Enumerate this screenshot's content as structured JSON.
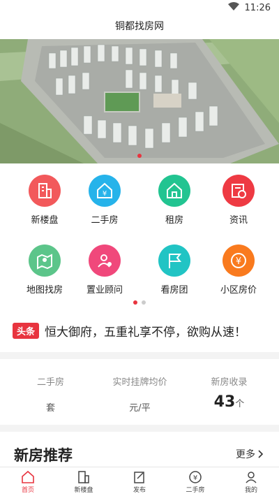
{
  "status_bar": {
    "time": "11:26"
  },
  "title": "铜都找房网",
  "banner": {
    "dot_count": 1
  },
  "grid": {
    "items": [
      {
        "label": "新楼盘",
        "icon": "building-icon",
        "color": "#f2595b"
      },
      {
        "label": "二手房",
        "icon": "yuan-house-icon",
        "color": "#26b3ea"
      },
      {
        "label": "租房",
        "icon": "house-icon",
        "color": "#22c491"
      },
      {
        "label": "资讯",
        "icon": "news-clock-icon",
        "color": "#ee3a43"
      },
      {
        "label": "地图找房",
        "icon": "map-pin-icon",
        "color": "#5cc58a"
      },
      {
        "label": "置业顾问",
        "icon": "advisor-icon",
        "color": "#f0487b"
      },
      {
        "label": "看房团",
        "icon": "flag-icon",
        "color": "#21c4c4"
      },
      {
        "label": "小区房价",
        "icon": "yuan-coin-icon",
        "color": "#f97a1e"
      }
    ],
    "page_count": 2,
    "active_page": 1
  },
  "headline": {
    "badge": "头条",
    "text": "恒大御府，五重礼享不停，欲购从速！"
  },
  "stats": {
    "second_hand": {
      "label": "二手房",
      "value": "",
      "unit": "套"
    },
    "avg_price": {
      "label": "实时挂牌均价",
      "value": "",
      "unit": "元/平"
    },
    "new_house": {
      "label": "新房收录",
      "value": "43",
      "unit": "个"
    }
  },
  "section": {
    "title": "新房推荐",
    "more": "更多"
  },
  "tabbar": {
    "items": [
      {
        "label": "首页",
        "icon": "home-icon",
        "active": true
      },
      {
        "label": "新楼盘",
        "icon": "building-icon",
        "active": false
      },
      {
        "label": "发布",
        "icon": "edit-icon",
        "active": false
      },
      {
        "label": "二手房",
        "icon": "yuan-icon",
        "active": false
      },
      {
        "label": "我的",
        "icon": "user-icon",
        "active": false
      }
    ]
  },
  "colors": {
    "accent": "#e8343f"
  }
}
